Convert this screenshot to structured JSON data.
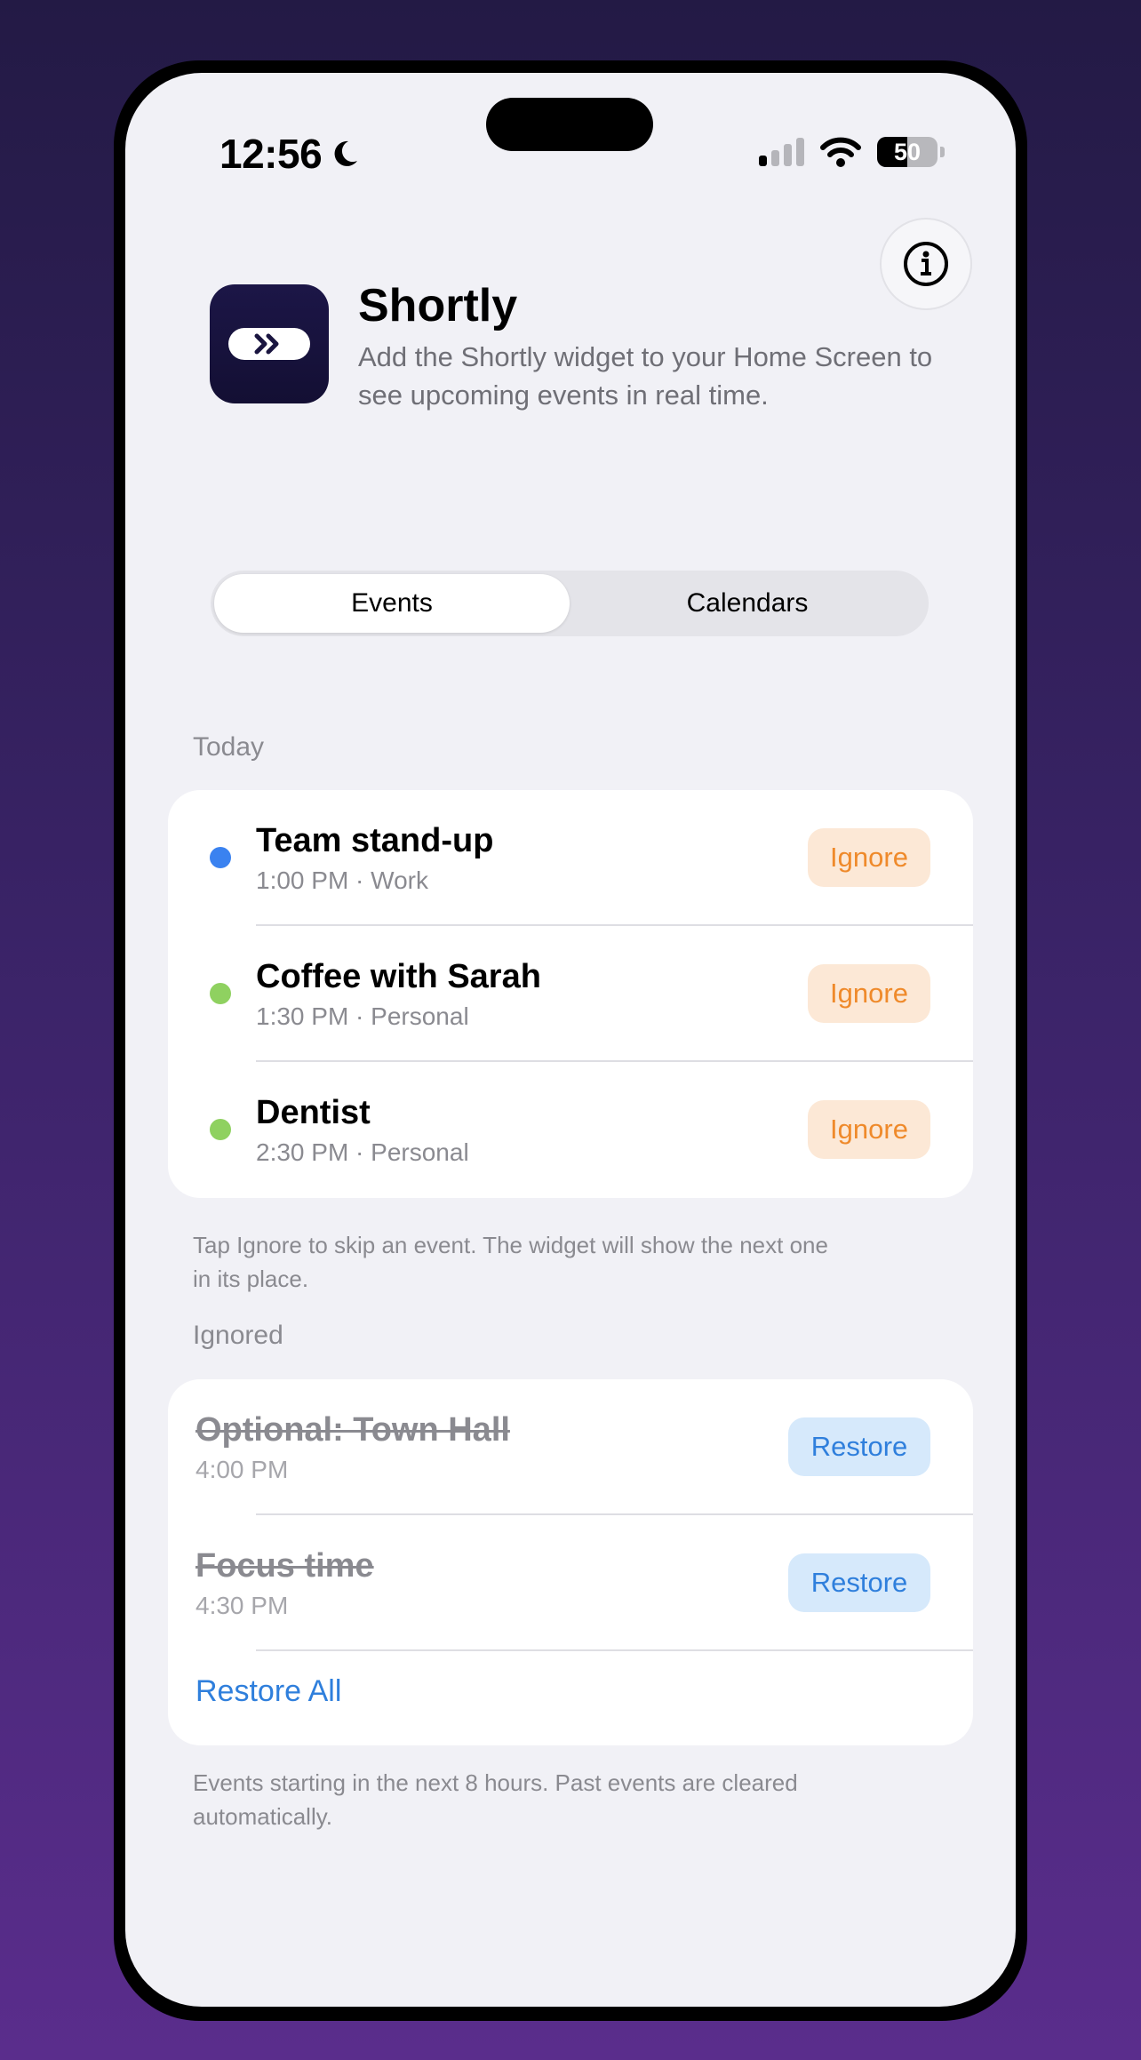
{
  "status_bar": {
    "time": "12:56",
    "battery": "50",
    "battery_level": 0.5
  },
  "app": {
    "name": "Shortly",
    "description": "Add the Shortly widget to your Home Screen to see upcoming events in real time."
  },
  "tabs": [
    {
      "label": "Events",
      "selected": true
    },
    {
      "label": "Calendars",
      "selected": false
    }
  ],
  "today": {
    "header": "Today",
    "events": [
      {
        "title": "Team stand-up",
        "subtitle": "1:00 PM · Work",
        "color": "#3a82f0",
        "action": "Ignore"
      },
      {
        "title": "Coffee with Sarah",
        "subtitle": "1:30 PM · Personal",
        "color": "#8fd160",
        "action": "Ignore"
      },
      {
        "title": "Dentist",
        "subtitle": "2:30 PM · Personal",
        "color": "#8fd160",
        "action": "Ignore"
      }
    ],
    "footer": "Tap Ignore to skip an event. The widget will show the next one in its place."
  },
  "ignored": {
    "header": "Ignored",
    "events": [
      {
        "title": "Optional: Town Hall",
        "subtitle": "4:00 PM",
        "action": "Restore"
      },
      {
        "title": "Focus time",
        "subtitle": "4:30 PM",
        "action": "Restore"
      }
    ],
    "restore_all": "Restore All",
    "footer": "Events starting in the next 8 hours. Past events are cleared automatically."
  },
  "colors": {
    "accent_blue": "#2f7fdc",
    "ignore_orange": "#ef8a2b"
  }
}
